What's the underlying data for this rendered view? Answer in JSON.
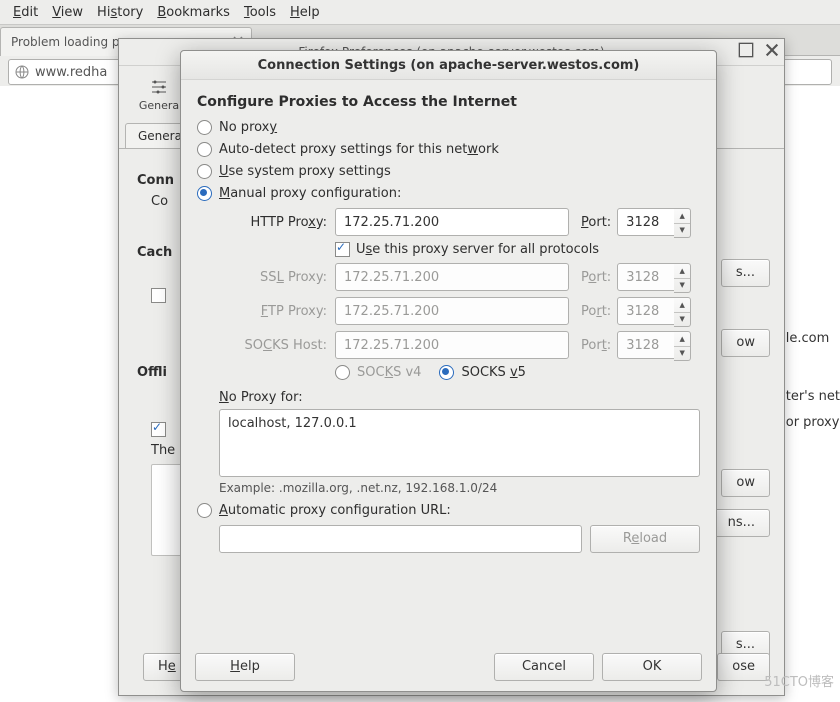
{
  "menubar": {
    "edit": "Edit",
    "view": "View",
    "history": "History",
    "bookmarks": "Bookmarks",
    "tools": "Tools",
    "help": "Help"
  },
  "tab": {
    "title": "Problem loading pa"
  },
  "url": {
    "value": "www.redha"
  },
  "page": {
    "t1": "le.com",
    "t2": "ter's net",
    "t3": "or proxy"
  },
  "prefs": {
    "title": "Firefox Preferences (on apache-server.westos.com)",
    "cat_general": "Genera",
    "tab_general": "Genera",
    "s_conn": "Conn",
    "s_conn_sub": "Co",
    "s_cache": "Cach",
    "s_offline": "Offli",
    "s_the": "The",
    "btn_settings": "s...",
    "btn_ow": "ow",
    "btn_ns": "ns...",
    "btn_help": "Help",
    "btn_close": "ose"
  },
  "dlg": {
    "title": "Connection Settings (on apache-server.westos.com)",
    "heading": "Configure Proxies to Access the Internet",
    "r_no": "No proxy",
    "r_auto": "Auto-detect proxy settings for this network",
    "r_sys": "Use system proxy settings",
    "r_manual": "Manual proxy configuration:",
    "http_label": "HTTP Proxy:",
    "http_host": "172.25.71.200",
    "http_port": "3128",
    "port_label": "Port:",
    "use_all": "Use this proxy server for all protocols",
    "ssl_label": "SSL Proxy:",
    "ssl_host": "172.25.71.200",
    "ssl_port": "3128",
    "ftp_label": "FTP Proxy:",
    "ftp_host": "172.25.71.200",
    "ftp_port": "3128",
    "socks_label": "SOCKS Host:",
    "socks_host": "172.25.71.200",
    "socks_port": "3128",
    "socks_v4": "SOCKS v4",
    "socks_v5": "SOCKS v5",
    "noproxy_label": "No Proxy for:",
    "noproxy_value": "localhost, 127.0.0.1",
    "example": "Example: .mozilla.org, .net.nz, 192.168.1.0/24",
    "r_autourl": "Automatic proxy configuration URL:",
    "reload": "Reload",
    "help": "Help",
    "cancel": "Cancel",
    "ok": "OK"
  },
  "watermark": "51CTO博客"
}
